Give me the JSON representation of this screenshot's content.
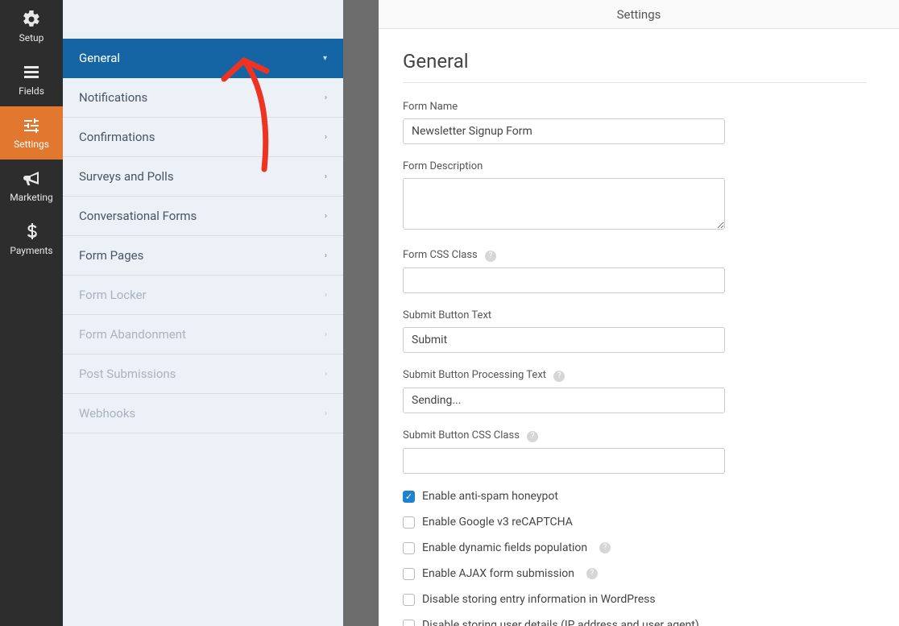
{
  "topbar": {
    "title": "Settings"
  },
  "rail": [
    {
      "key": "setup",
      "label": "Setup",
      "active": false
    },
    {
      "key": "fields",
      "label": "Fields",
      "active": false
    },
    {
      "key": "settings",
      "label": "Settings",
      "active": true
    },
    {
      "key": "marketing",
      "label": "Marketing",
      "active": false
    },
    {
      "key": "payments",
      "label": "Payments",
      "active": false
    }
  ],
  "menu": [
    {
      "label": "General",
      "active": true,
      "disabled": false
    },
    {
      "label": "Notifications",
      "active": false,
      "disabled": false
    },
    {
      "label": "Confirmations",
      "active": false,
      "disabled": false
    },
    {
      "label": "Surveys and Polls",
      "active": false,
      "disabled": false
    },
    {
      "label": "Conversational Forms",
      "active": false,
      "disabled": false
    },
    {
      "label": "Form Pages",
      "active": false,
      "disabled": false
    },
    {
      "label": "Form Locker",
      "active": false,
      "disabled": true
    },
    {
      "label": "Form Abandonment",
      "active": false,
      "disabled": true
    },
    {
      "label": "Post Submissions",
      "active": false,
      "disabled": true
    },
    {
      "label": "Webhooks",
      "active": false,
      "disabled": true
    }
  ],
  "panel": {
    "heading": "General",
    "form_name_label": "Form Name",
    "form_name_value": "Newsletter Signup Form",
    "form_desc_label": "Form Description",
    "form_desc_value": "",
    "form_css_label": "Form CSS Class",
    "form_css_value": "",
    "submit_text_label": "Submit Button Text",
    "submit_text_value": "Submit",
    "submit_proc_label": "Submit Button Processing Text",
    "submit_proc_value": "Sending...",
    "submit_css_label": "Submit Button CSS Class",
    "submit_css_value": "",
    "checks": [
      {
        "label": "Enable anti-spam honeypot",
        "checked": true,
        "help": false
      },
      {
        "label": "Enable Google v3 reCAPTCHA",
        "checked": false,
        "help": false
      },
      {
        "label": "Enable dynamic fields population",
        "checked": false,
        "help": true
      },
      {
        "label": "Enable AJAX form submission",
        "checked": false,
        "help": true
      },
      {
        "label": "Disable storing entry information in WordPress",
        "checked": false,
        "help": false
      },
      {
        "label": "Disable storing user details (IP address and user agent)",
        "checked": false,
        "help": false
      }
    ]
  }
}
